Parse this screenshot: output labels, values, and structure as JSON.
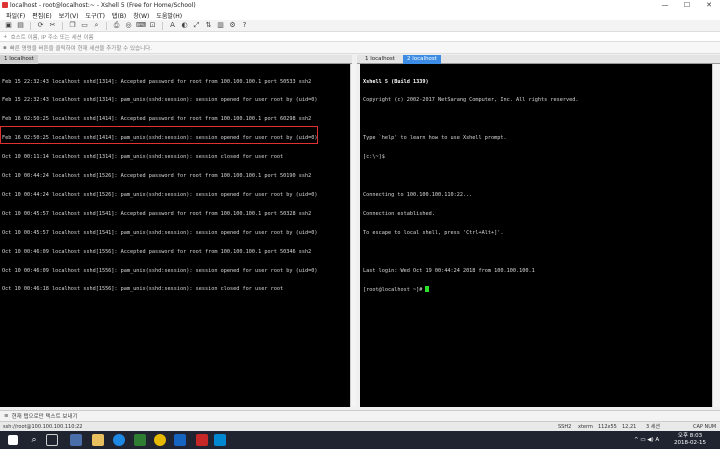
{
  "window": {
    "title": "localhost - root@localhost:~ - Xshell 5 (Free for Home/School)",
    "minimize": "—",
    "maximize": "☐",
    "close": "✕"
  },
  "menu": [
    "파일(F)",
    "편집(E)",
    "보기(V)",
    "도구(T)",
    "탭(B)",
    "창(W)",
    "도움말(H)"
  ],
  "address": {
    "placeholder": "호스트 이름, IP 주소 또는 세션 이름"
  },
  "links": {
    "text": "빠른 명령을 버튼을 클릭하여 현재 세션을 추가할 수 있습니다."
  },
  "left_tab": {
    "label": "1 localhost"
  },
  "right_tabs": [
    {
      "label": "1 localhost"
    },
    {
      "label": "2 localhost"
    }
  ],
  "left_terminal": [
    "Feb 15 22:32:43 localhost sshd[1314]: Accepted password for root from 100.100.100.1 port 50533 ssh2",
    "Feb 15 22:32:43 localhost sshd[1314]: pam_unix(sshd:session): session opened for user root by (uid=0)",
    "Feb 16 02:50:25 localhost sshd[1414]: Accepted password for root from 100.100.100.1 port 60298 ssh2",
    "Feb 16 02:50:25 localhost sshd[1414]: pam_unix(sshd:session): session opened for user root by (uid=0)",
    "Oct 10 00:11:14 localhost sshd[1314]: pam_unix(sshd:session): session closed for user root",
    "Oct 10 00:44:24 localhost sshd[1526]: Accepted password for root from 100.100.100.1 port 50190 ssh2",
    "Oct 10 00:44:24 localhost sshd[1526]: pam_unix(sshd:session): session opened for user root by (uid=0)",
    "Oct 10 00:45:57 localhost sshd[1541]: Accepted password for root from 100.100.100.1 port 50328 ssh2",
    "Oct 10 00:45:57 localhost sshd[1541]: pam_unix(sshd:session): session opened for user root by (uid=0)",
    "Oct 10 00:46:09 localhost sshd[1556]: Accepted password for root from 100.100.100.1 port 50346 ssh2",
    "Oct 10 00:46:09 localhost sshd[1556]: pam_unix(sshd:session): session opened for user root by (uid=0)",
    "Oct 10 00:46:18 localhost sshd[1556]: pam_unix(sshd:session): session closed for user root"
  ],
  "right_terminal": [
    "Xshell 5 (Build 1339)",
    "Copyright (c) 2002-2017 NetSarang Computer, Inc. All rights reserved.",
    "",
    "Type `help' to learn how to use Xshell prompt.",
    "[c:\\~]$",
    "",
    "Connecting to 100.100.100.110:22...",
    "Connection established.",
    "To escape to local shell, press 'Ctrl+Alt+]'.",
    "",
    "Last login: Wed Oct 19 00:44:24 2018 from 100.100.100.1",
    "[root@localhost ~]# "
  ],
  "compose": {
    "text": "현재 탭으로만 텍스트 보내기"
  },
  "status": {
    "session": "ssh://root@100.100.100.110:22",
    "protocol": "SSH2",
    "term": "xterm",
    "size": "112x55",
    "pos": "12,21",
    "sessions": "3 세션",
    "caps": "CAP NUM"
  },
  "clock": {
    "time": "오후 8:03",
    "date": "2018-02-15"
  },
  "colors": {
    "highlight": "#e03030",
    "cursor": "#2ee02e",
    "active_tab": "#3c8ce6"
  }
}
